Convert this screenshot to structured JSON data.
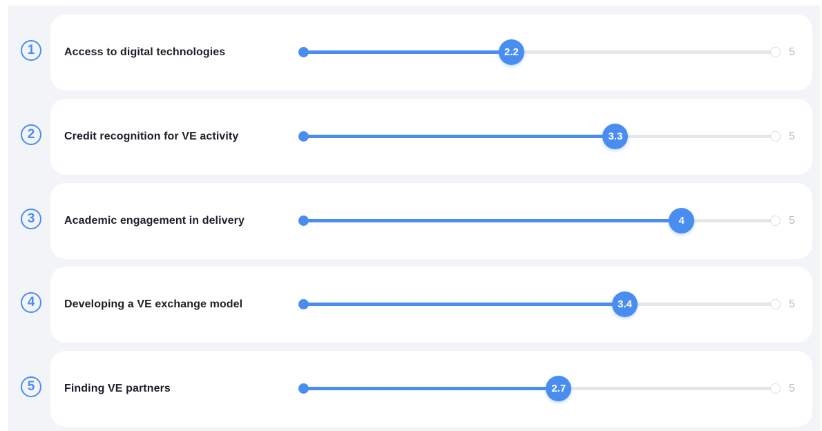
{
  "scale_max": 5,
  "accent_color": "#4a8df0",
  "items": [
    {
      "number": "1",
      "label": "Access to digital technologies",
      "value": "2.2",
      "max_label": "5"
    },
    {
      "number": "2",
      "label": "Credit recognition for VE activity",
      "value": "3.3",
      "max_label": "5"
    },
    {
      "number": "3",
      "label": "Academic engagement in delivery",
      "value": "4",
      "max_label": "5"
    },
    {
      "number": "4",
      "label": "Developing a VE exchange model",
      "value": "3.4",
      "max_label": "5"
    },
    {
      "number": "5",
      "label": "Finding VE partners",
      "value": "2.7",
      "max_label": "5"
    }
  ]
}
